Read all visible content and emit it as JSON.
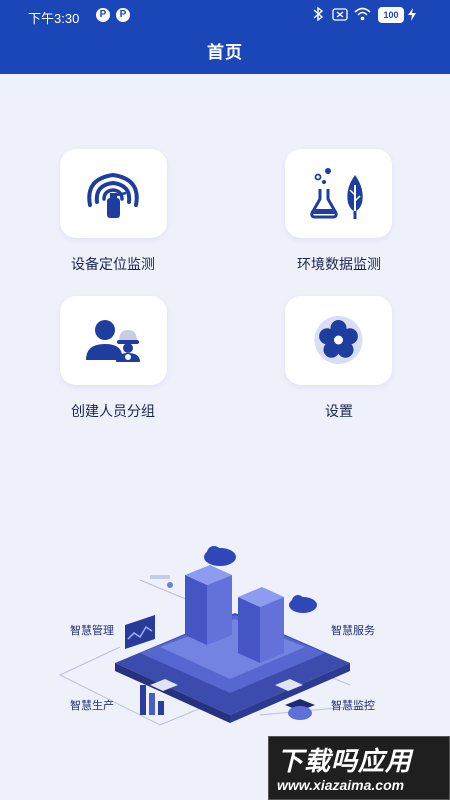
{
  "status_bar": {
    "time": "下午3:30",
    "p1": "P",
    "p2": "P",
    "battery": "100"
  },
  "header": {
    "title": "首页"
  },
  "menu": {
    "device_location": "设备定位监测",
    "environment_data": "环境数据监测",
    "create_group": "创建人员分组",
    "settings": "设置"
  },
  "illustration": {
    "smart_management": "智慧管理",
    "smart_service": "智慧服务",
    "smart_production": "智慧生产",
    "smart_monitoring": "智慧监控"
  },
  "watermark": {
    "main": "下载吗应用",
    "site": "www.xiazaima.com"
  },
  "colors": {
    "header": "#1a46b8",
    "background": "#eef0fa",
    "icon_blue": "#1d3e9e"
  }
}
